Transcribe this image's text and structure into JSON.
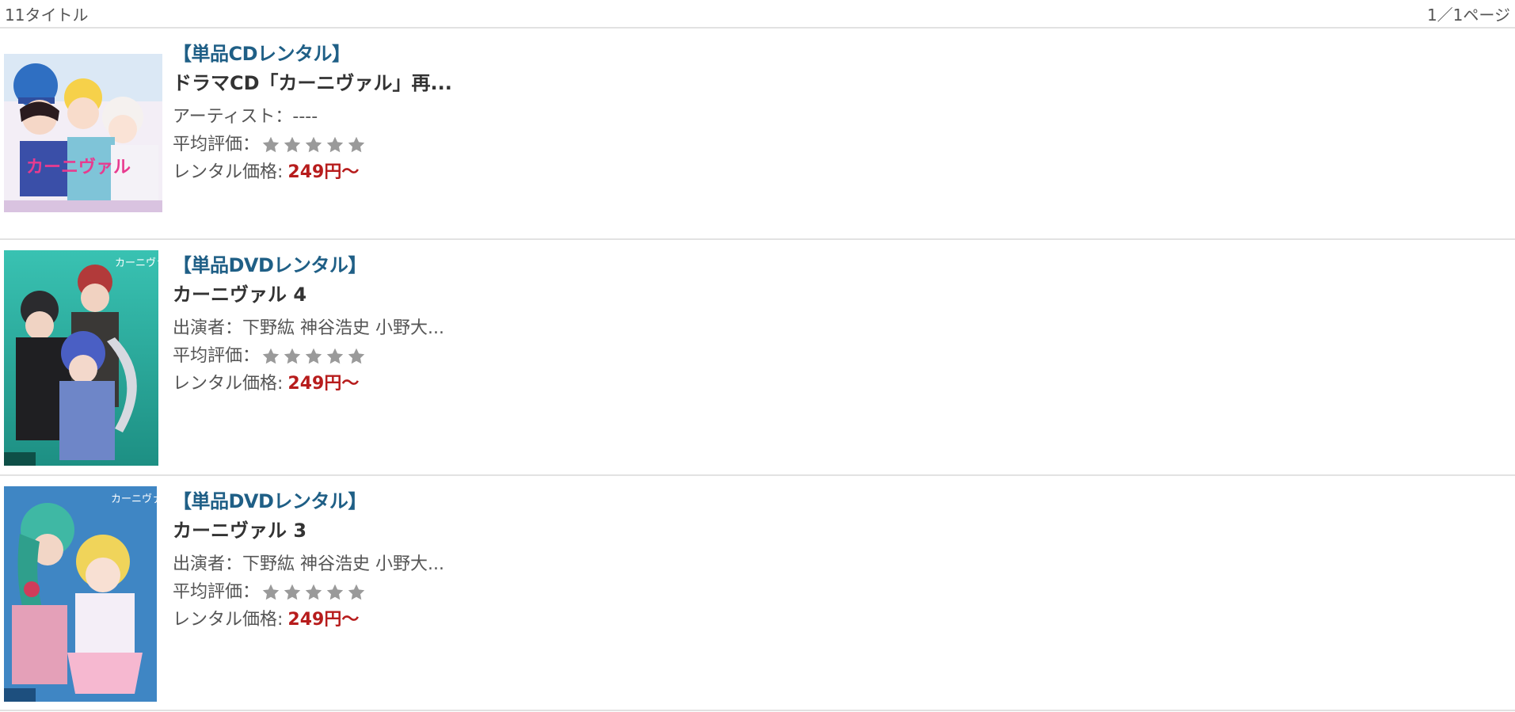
{
  "header": {
    "count": "11タイトル",
    "page": "1／1ページ"
  },
  "items": [
    {
      "category": "【単品CDレンタル】",
      "title": "ドラマCD「カーニヴァル」再...",
      "meta_label": "アーティスト：",
      "meta_value": "----",
      "rating_label": "平均評価：",
      "rating": 0,
      "price_label": "レンタル価格:",
      "price": "249円〜"
    },
    {
      "category": "【単品DVDレンタル】",
      "title": "カーニヴァル 4",
      "meta_label": "出演者：",
      "meta_value": "下野紘 神谷浩史 小野大...",
      "rating_label": "平均評価：",
      "rating": 0,
      "price_label": "レンタル価格:",
      "price": "249円〜"
    },
    {
      "category": "【単品DVDレンタル】",
      "title": "カーニヴァル 3",
      "meta_label": "出演者：",
      "meta_value": "下野紘 神谷浩史 小野大...",
      "rating_label": "平均評価：",
      "rating": 0,
      "price_label": "レンタル価格:",
      "price": "249円〜"
    }
  ],
  "colors": {
    "category": "#1f5f86",
    "price": "#b71c1c",
    "star_empty": "#9a9a9a"
  }
}
